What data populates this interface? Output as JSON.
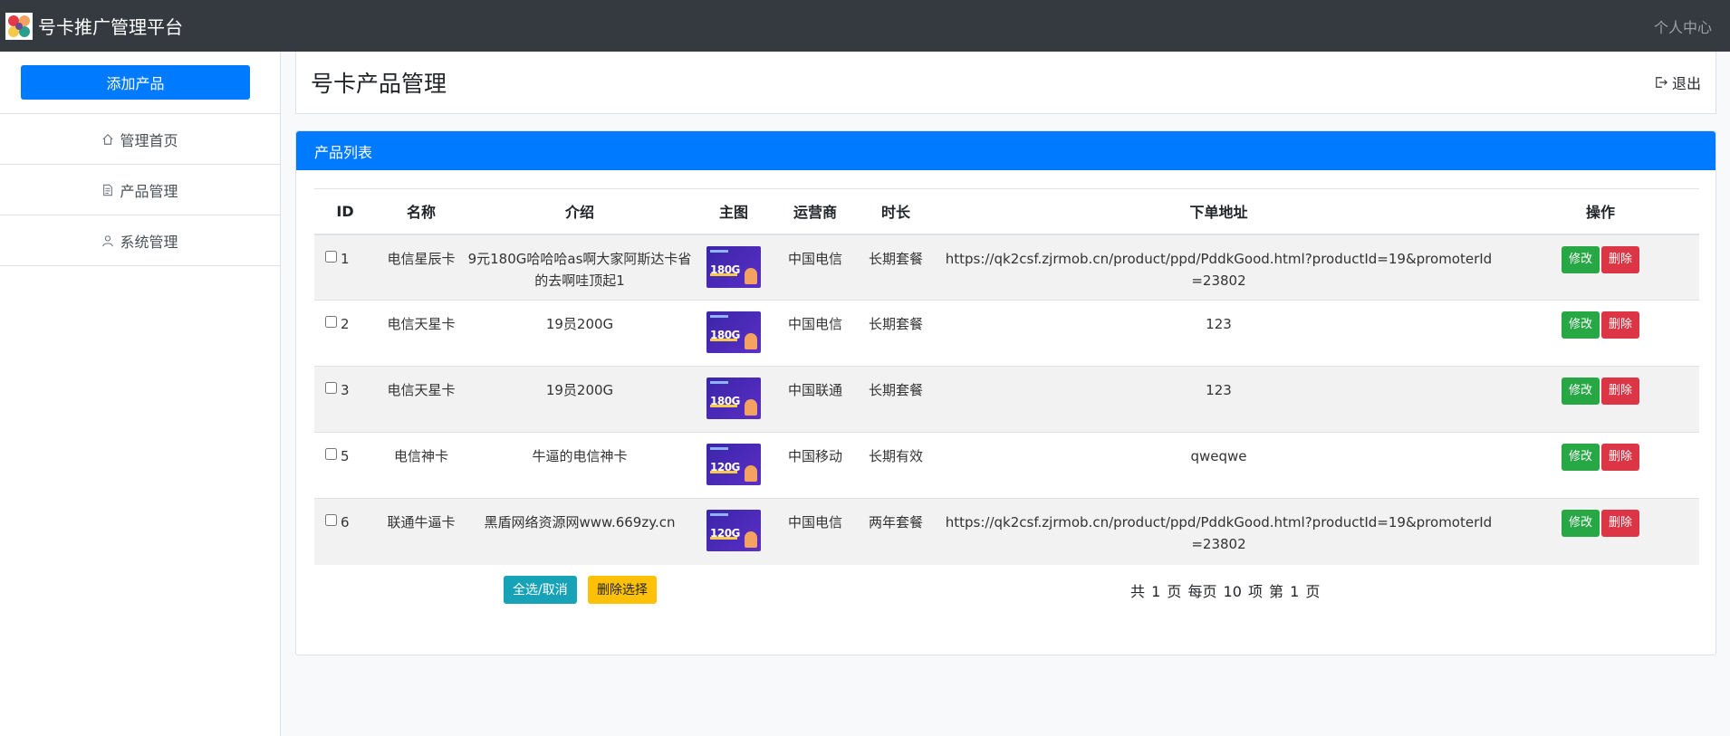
{
  "topbar": {
    "title": "号卡推广管理平台",
    "user_center": "个人中心"
  },
  "sidebar": {
    "add_button": "添加产品",
    "items": [
      {
        "label": "管理首页",
        "icon": "home-icon"
      },
      {
        "label": "产品管理",
        "icon": "document-icon"
      },
      {
        "label": "系统管理",
        "icon": "user-icon"
      }
    ]
  },
  "header": {
    "title": "号卡产品管理",
    "logout": "退出"
  },
  "card": {
    "title": "产品列表"
  },
  "table": {
    "columns": [
      "ID",
      "名称",
      "介绍",
      "主图",
      "运营商",
      "时长",
      "下单地址",
      "操作"
    ],
    "rows": [
      {
        "id": "1",
        "name": "电信星辰卡",
        "intro": "9元180G哈哈哈as啊大家阿斯达卡省的去啊哇顶起1",
        "image_label": "180G",
        "operator": "中国电信",
        "duration": "长期套餐",
        "url": "https://qk2csf.zjrmob.cn/product/ppd/PddkGood.html?productId=19&promoterId=23802"
      },
      {
        "id": "2",
        "name": "电信天星卡",
        "intro": "19员200G",
        "image_label": "180G",
        "operator": "中国电信",
        "duration": "长期套餐",
        "url": "123"
      },
      {
        "id": "3",
        "name": "电信天星卡",
        "intro": "19员200G",
        "image_label": "180G",
        "operator": "中国联通",
        "duration": "长期套餐",
        "url": "123"
      },
      {
        "id": "5",
        "name": "电信神卡",
        "intro": "牛逼的电信神卡",
        "image_label": "120G",
        "operator": "中国移动",
        "duration": "长期有效",
        "url": "qweqwe"
      },
      {
        "id": "6",
        "name": "联通牛逼卡",
        "intro": "黑盾网络资源网www.669zy.cn",
        "image_label": "120G",
        "operator": "中国电信",
        "duration": "两年套餐",
        "url": "https://qk2csf.zjrmob.cn/product/ppd/PddkGood.html?productId=19&promoterId=23802"
      }
    ],
    "edit_label": "修改",
    "delete_label": "删除"
  },
  "footer": {
    "select_all": "全选/取消",
    "delete_selected": "删除选择",
    "pager": "共 1 页  每页 10 项   第 1 页"
  },
  "colors": {
    "primary": "#007bff",
    "success": "#28a745",
    "danger": "#dc3545",
    "info": "#17a2b8",
    "warning": "#ffc107",
    "topbar": "#343a40"
  }
}
